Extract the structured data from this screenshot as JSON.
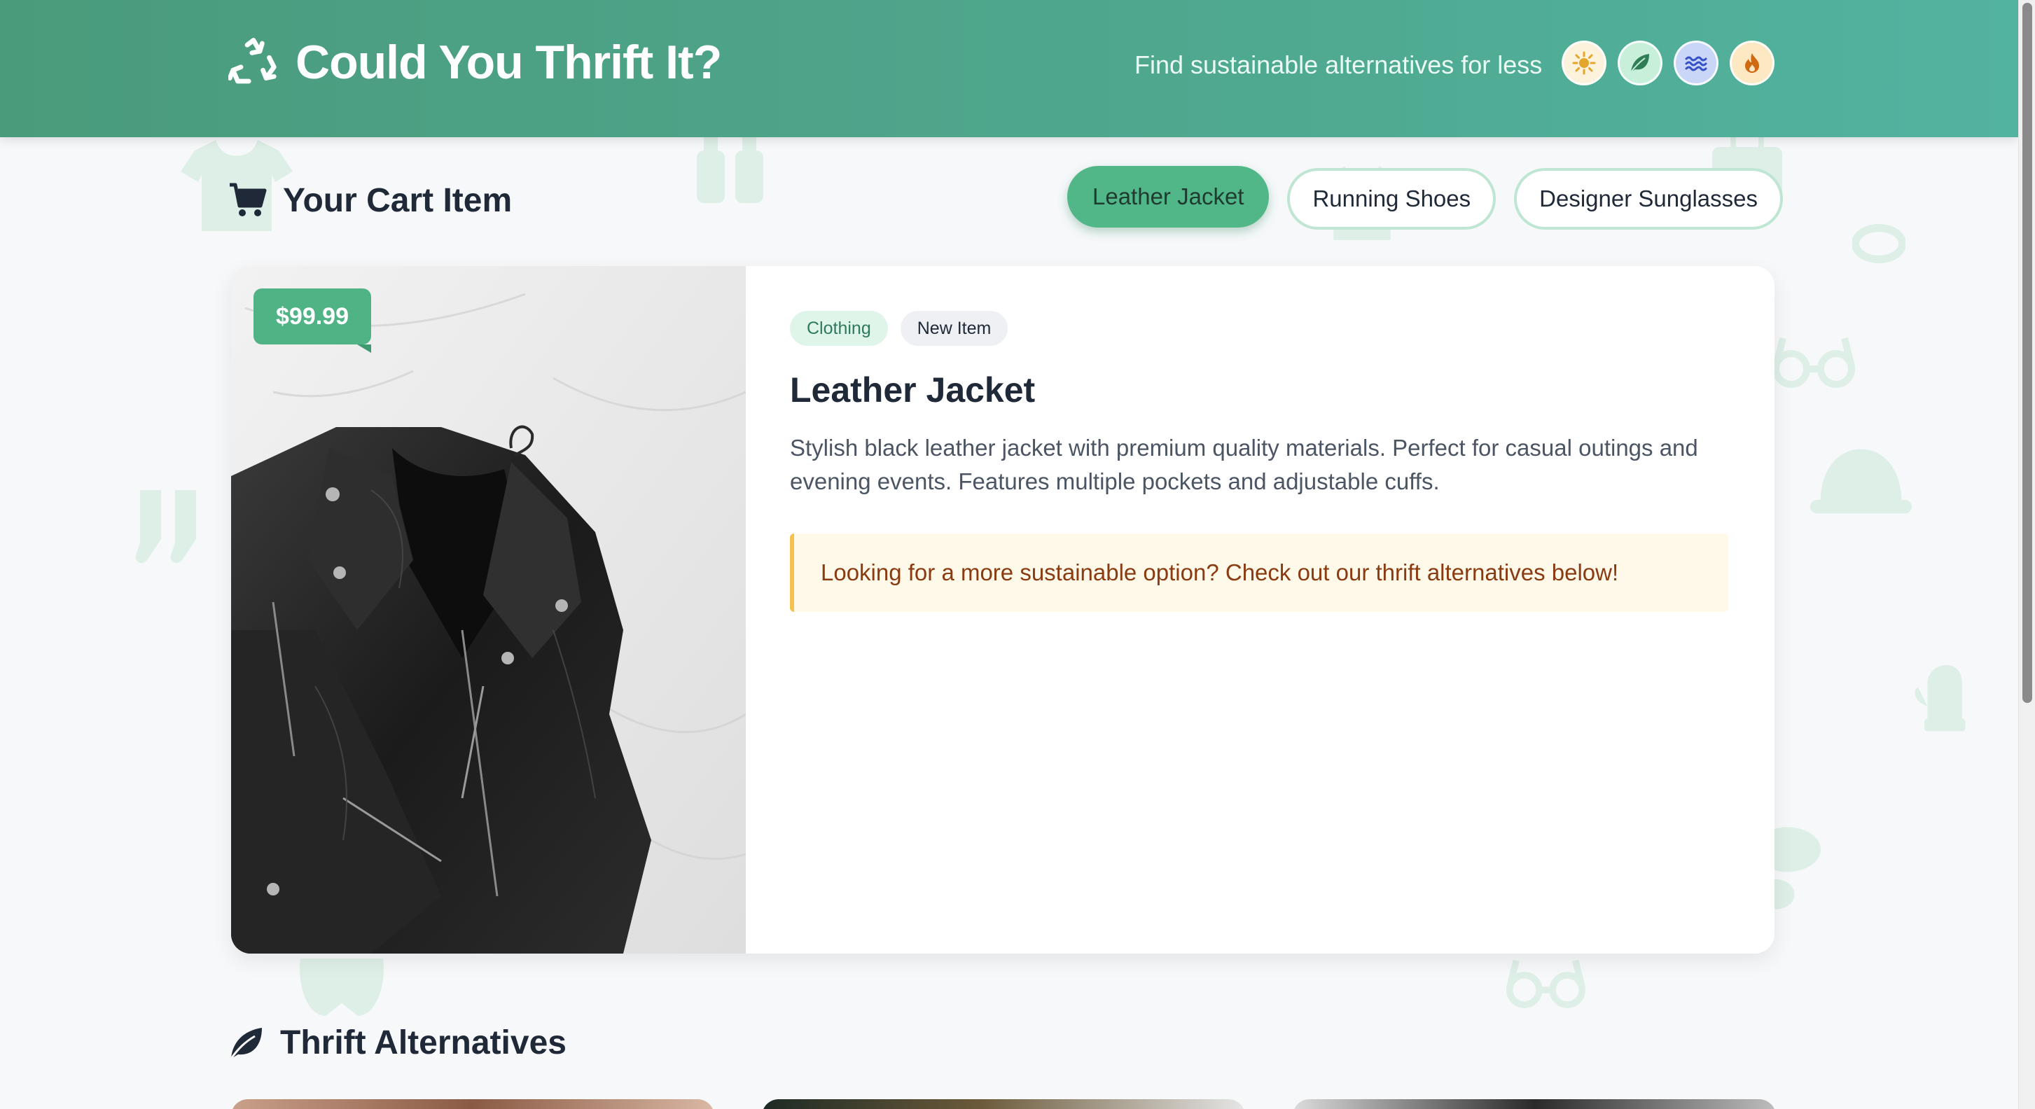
{
  "header": {
    "title": "Could You Thrift It?",
    "tagline": "Find sustainable alternatives for less",
    "themes": [
      {
        "name": "sun-theme",
        "icon": "sun-icon",
        "bg": "#fdf3dc",
        "color": "#e3a52b"
      },
      {
        "name": "leaf-theme",
        "icon": "leaf-icon",
        "bg": "#c8efd9",
        "color": "#2e7d57"
      },
      {
        "name": "ocean-theme",
        "icon": "water-icon",
        "bg": "#c9d6f8",
        "color": "#3452c5"
      },
      {
        "name": "fire-theme",
        "icon": "fire-icon",
        "bg": "#fde8c4",
        "color": "#d06a10"
      }
    ]
  },
  "cart": {
    "heading": "Your Cart Item",
    "tabs": [
      "Leather Jacket",
      "Running Shoes",
      "Designer Sunglasses"
    ],
    "active_tab": "Leather Jacket",
    "item": {
      "price": "$99.99",
      "category": "Clothing",
      "condition": "New Item",
      "title": "Leather Jacket",
      "description": "Stylish black leather jacket with premium quality materials. Perfect for casual outings and evening events. Features multiple pockets and adjustable cuffs.",
      "notice": "Looking for a more sustainable option? Check out our thrift alternatives below!"
    }
  },
  "alternatives": {
    "heading": "Thrift Alternatives"
  },
  "colors": {
    "brand": "#4fa88f",
    "accent": "#52b788",
    "notice_border": "#f4c34d"
  }
}
